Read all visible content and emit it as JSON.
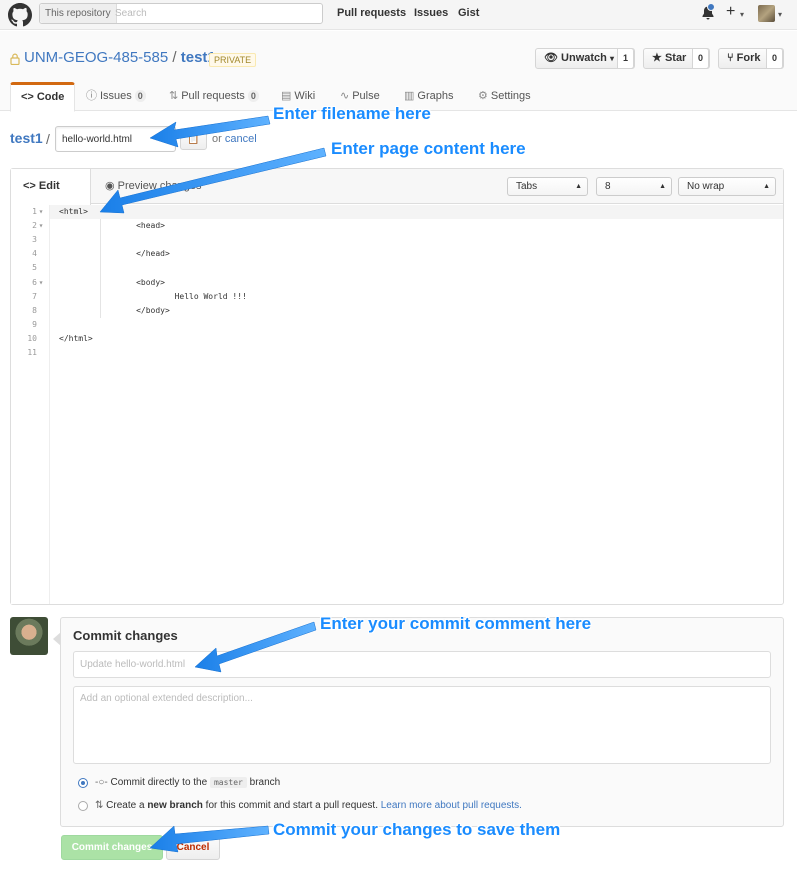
{
  "header": {
    "search_scope": "This repository",
    "search_placeholder": "Search",
    "nav": [
      "Pull requests",
      "Issues",
      "Gist"
    ],
    "plus_symbol": "+"
  },
  "repo": {
    "owner": "UNM-GEOG-485-585",
    "separator": "/",
    "name": "test1",
    "visibility": "PRIVATE",
    "unwatch_label": "Unwatch",
    "unwatch_count": "1",
    "star_label": "Star",
    "star_count": "0",
    "fork_label": "Fork",
    "fork_count": "0"
  },
  "tabs": [
    {
      "label": "Code",
      "icon": "code-icon"
    },
    {
      "label": "Issues",
      "count": "0",
      "icon": "issue-icon"
    },
    {
      "label": "Pull requests",
      "count": "0",
      "icon": "pull-request-icon"
    },
    {
      "label": "Wiki",
      "icon": "book-icon"
    },
    {
      "label": "Pulse",
      "icon": "pulse-icon"
    },
    {
      "label": "Graphs",
      "icon": "graph-icon"
    },
    {
      "label": "Settings",
      "icon": "gear-icon"
    }
  ],
  "file": {
    "breadcrumb": "test1",
    "separator": "/",
    "filename": "hello-world.html",
    "or_text": "or",
    "cancel_link": "cancel"
  },
  "editor": {
    "edit_tab": "Edit file",
    "preview_tab": "Preview changes",
    "indent_mode": "Tabs",
    "indent_size": "8",
    "wrap_mode": "No wrap",
    "lines": [
      "<html>",
      "                <head>",
      "",
      "                </head>",
      "",
      "                <body>",
      "                        Hello World !!!",
      "                </body>",
      "",
      "</html>",
      ""
    ],
    "line_numbers": [
      "1",
      "2",
      "3",
      "4",
      "5",
      "6",
      "7",
      "8",
      "9",
      "10",
      "11"
    ],
    "fold_markers": [
      "▾",
      "▾",
      "",
      "",
      "",
      "▾",
      "",
      "",
      "",
      "",
      ""
    ]
  },
  "commit": {
    "title": "Commit changes",
    "message_placeholder": "Update hello-world.html",
    "description_placeholder": "Add an optional extended description...",
    "option1_prefix": "Commit directly to the",
    "option1_branch": "master",
    "option1_suffix": "branch",
    "option2_prefix": "Create a",
    "option2_bold": "new branch",
    "option2_suffix": "for this commit and start a pull request.",
    "option2_link": "Learn more about pull requests.",
    "commit_button": "Commit changes",
    "cancel_button": "Cancel"
  },
  "annotations": {
    "filename": "Enter filename here",
    "content": "Enter page content here",
    "comment": "Enter your commit comment here",
    "save": "Commit your changes to save them",
    "color": "#1a8cff"
  }
}
